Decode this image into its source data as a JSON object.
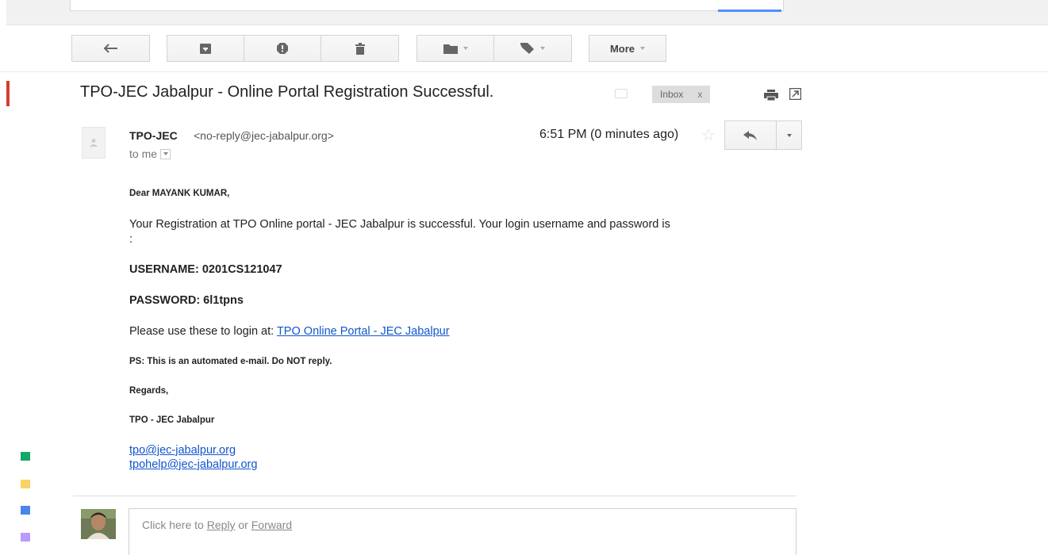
{
  "toolbar": {
    "more_label": "More"
  },
  "message": {
    "subject": "TPO-JEC Jabalpur - Online Portal Registration Successful.",
    "label": "Inbox",
    "label_remove": "x",
    "sender_name": "TPO-JEC",
    "sender_email": "<no-reply@jec-jabalpur.org>",
    "to": "to me",
    "time": "6:51 PM (0 minutes ago)"
  },
  "body": {
    "greeting": "Dear MAYANK KUMAR,",
    "intro_line1": "Your Registration at TPO Online portal - JEC Jabalpur is successful. Your login username and password is",
    "intro_line2": ":",
    "username": "USERNAME: 0201CS121047",
    "password": "PASSWORD: 6l1tpns",
    "login_prefix": "Please use these to login at: ",
    "login_link": "TPO Online Portal - JEC Jabalpur",
    "ps": "PS: This is an automated e-mail. Do NOT reply.",
    "regards": "Regards,",
    "signature": "TPO - JEC Jabalpur",
    "email1": "tpo@jec-jabalpur.org",
    "email2": "tpohelp@jec-jabalpur.org"
  },
  "reply_box": {
    "prefix": "Click here to ",
    "reply": "Reply",
    "or": " or ",
    "forward": "Forward"
  },
  "colors": {
    "link": "#1155cc",
    "accent_red": "#d23f31",
    "swatches": [
      "#16a765",
      "#fad165",
      "#4986e7",
      "#b99aff"
    ]
  }
}
